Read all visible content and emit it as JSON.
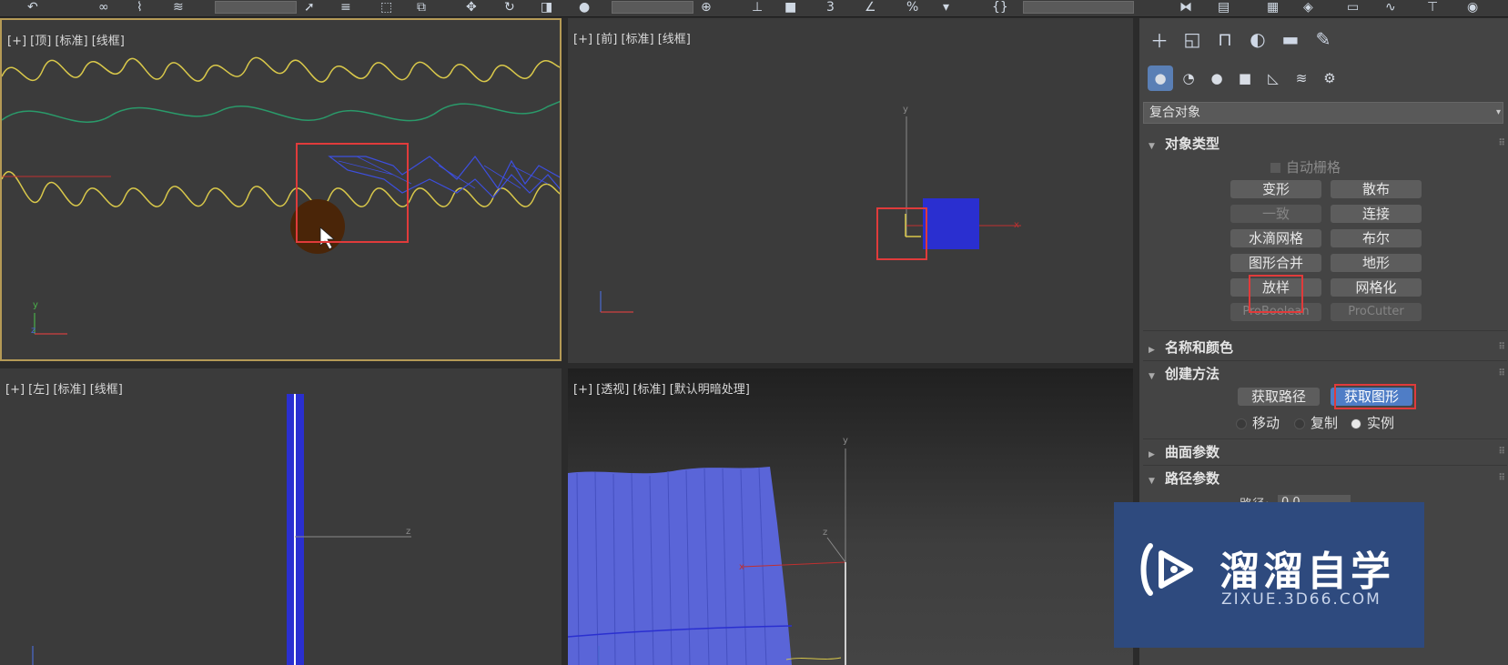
{
  "viewports": {
    "top": {
      "label": "[+] [顶] [标准] [线框]"
    },
    "front": {
      "label": "[+] [前] [标准] [线框]"
    },
    "left": {
      "label": "[+] [左] [标准] [线框]"
    },
    "persp": {
      "label": "[+] [透视] [标准] [默认明暗处理]"
    }
  },
  "panel": {
    "dropdown": "复合对象",
    "rollouts": {
      "object_type": "对象类型",
      "name_color": "名称和颜色",
      "creation_method": "创建方法",
      "surface_params": "曲面参数",
      "path_params": "路径参数"
    },
    "auto_grid": "自动栅格",
    "buttons": [
      "变形",
      "散布",
      "一致",
      "连接",
      "水滴网格",
      "布尔",
      "图形合并",
      "地形",
      "放样",
      "网格化",
      "ProBoolean",
      "ProCutter"
    ],
    "creation_buttons": [
      "获取路径",
      "获取图形"
    ],
    "radios": [
      "移动",
      "复制",
      "实例"
    ],
    "path_label": "路径:",
    "path_value": "0.0"
  },
  "watermark": {
    "title": "溜溜自学",
    "subtitle": "ZIXUE.3D66.COM"
  },
  "colors": {
    "accent_blue": "#4f7dc6",
    "highlight_red": "#e03b3b",
    "viewport_active": "#b59a56"
  }
}
